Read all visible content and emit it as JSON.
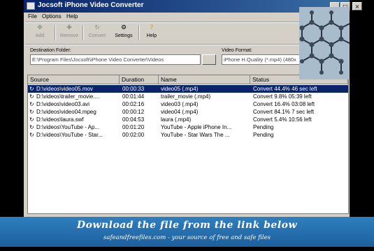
{
  "window": {
    "title": "Jocsoft iPhone Video Converter"
  },
  "menu": [
    {
      "label": "File"
    },
    {
      "label": "Options"
    },
    {
      "label": "Help"
    }
  ],
  "toolbar": {
    "add_label": "Add",
    "remove_label": "Remove",
    "convert_label": "Convert",
    "settings_label": "Settings",
    "help_label": "Help"
  },
  "destination": {
    "label": "Destination Folder:",
    "value": "E:\\Program Files\\Jocsoft\\iPhone Video Converter\\Videos"
  },
  "video_format": {
    "label": "Video Format:",
    "value": "iPhone H.Quality (*.mp4) (480x"
  },
  "list": {
    "columns": [
      "Source",
      "Duration",
      "Name",
      "Status"
    ],
    "rows": [
      {
        "source": "D:\\videos\\video05.mov",
        "duration": "00:00:33",
        "name": "video05 (.mp4)",
        "status": "Convert 44.4%  46 sec left",
        "selected": true
      },
      {
        "source": "D:\\videos\\trailer_movie....",
        "duration": "00:01:44",
        "name": "trailer_movie (.mp4)",
        "status": "Convert 9.8%  05:39 left",
        "selected": false
      },
      {
        "source": "D:\\videos\\video03.avi",
        "duration": "00:02:16",
        "name": "video03 (.mp4)",
        "status": "Convert 16.4%  03:08 left",
        "selected": false
      },
      {
        "source": "D:\\videos\\video04.mpeg",
        "duration": "00:00:12",
        "name": "video04 (.mp4)",
        "status": "Convert 84.1%  7 sec left",
        "selected": false
      },
      {
        "source": "D:\\videos\\laura.swf",
        "duration": "00:04:53",
        "name": "laura (.mp4)",
        "status": "Convert 5.4%  10:56 left",
        "selected": false
      },
      {
        "source": "D:\\videos\\YouTube - Ap...",
        "duration": "00:01:20",
        "name": "YouTube - Apple iPhone In...",
        "status": "Pending",
        "selected": false
      },
      {
        "source": "D:\\videos\\YouTube - Star...",
        "duration": "00:02:00",
        "name": "YouTube - Star Wars The ...",
        "status": "Pending",
        "selected": false
      }
    ]
  },
  "banner": {
    "line1": "Download the file from the link below",
    "line2": "safeandfreefiles.com  -  your source of free and safe files"
  },
  "colors": {
    "titlebar": "#0a246a",
    "selection": "#0a246a",
    "window_face": "#d4d0c8",
    "banner": "#2f7fbf"
  },
  "icons": [
    "add-icon",
    "remove-icon",
    "convert-icon",
    "settings-icon",
    "help-icon",
    "video-file-icon"
  ]
}
